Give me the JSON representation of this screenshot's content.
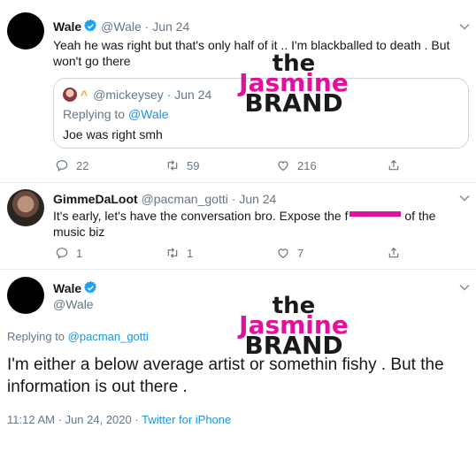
{
  "tweet1": {
    "name": "Wale",
    "handle": "@Wale",
    "separator": "·",
    "date": "Jun 24",
    "text": "Yeah he was right but that's only half of it .. I'm blackballed to death . But won't go there",
    "quote": {
      "handle": "@mickeysey",
      "separator": "·",
      "date": "Jun 24",
      "mark": "^",
      "replying_to_prefix": "Replying to ",
      "replying_to_handle": "@Wale",
      "text": "Joe was right smh"
    },
    "actions": {
      "replies": "22",
      "retweets": "59",
      "likes": "216"
    }
  },
  "tweet2": {
    "name": "GimmeDaLoot",
    "handle": "@pacman_gotti",
    "separator": "·",
    "date": "Jun 24",
    "text_before": "It's early, let's have the conversation bro. Expose the f",
    "text_after": " of the music biz",
    "actions": {
      "replies": "1",
      "retweets": "1",
      "likes": "7"
    }
  },
  "tweet3": {
    "name": "Wale",
    "handle": "@Wale",
    "replying_to_prefix": "Replying to ",
    "replying_to_handle": "@pacman_gotti",
    "text": "I'm either a below average artist or somethin fishy . But the information is out there .",
    "time": "11:12 AM",
    "separator": "·",
    "date": "Jun 24, 2020",
    "separator2": "·",
    "source": "Twitter for iPhone"
  },
  "watermark": {
    "line1": "the",
    "line2": "Jasmine",
    "line3": "BRAND"
  },
  "colors": {
    "link": "#1b95e0",
    "muted": "#657786",
    "verified": "#1da1f2",
    "watermark_accent": "#e0119d",
    "divider": "#e6ecf0"
  },
  "icons": [
    "verified-badge-icon",
    "chevron-down-icon",
    "reply-icon",
    "retweet-icon",
    "like-icon",
    "share-icon"
  ]
}
